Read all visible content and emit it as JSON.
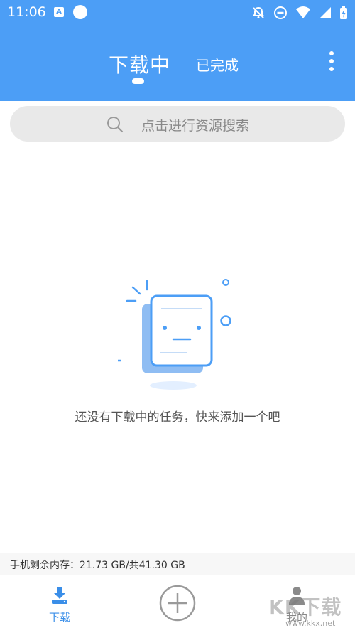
{
  "status_bar": {
    "time": "11:06",
    "app_icon_letter": "A"
  },
  "header": {
    "tabs": [
      {
        "label": "下载中",
        "active": true
      },
      {
        "label": "已完成",
        "active": false
      }
    ],
    "accent_color": "#4c9ef6"
  },
  "search": {
    "placeholder": "点击进行资源搜索"
  },
  "empty_state": {
    "message": "还没有下载中的任务，快来添加一个吧"
  },
  "storage": {
    "text": "手机剩余内存：21.73 GB/共41.30 GB"
  },
  "bottom_nav": {
    "download_label": "下载",
    "mine_label": "我的"
  },
  "watermark": {
    "main": "KK下载",
    "url": "www.kkx.net"
  }
}
